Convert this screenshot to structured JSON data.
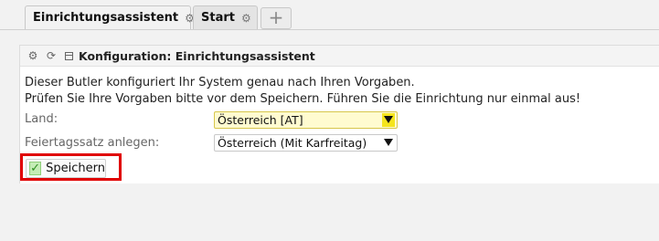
{
  "tabs": [
    {
      "label": "Einrichtungsassistent",
      "icon": "gear-icon",
      "active": true
    },
    {
      "label": "Start",
      "icon": "gear-icon",
      "active": false
    }
  ],
  "add_tab_icon": "plus-icon",
  "panel": {
    "title": "Konfiguration: Einrichtungsassistent",
    "description_line1": "Dieser Butler konfiguriert Ihr System genau nach Ihren Vorgaben.",
    "description_line2": "Prüfen Sie Ihre Vorgaben bitte vor dem Speichern. Führen Sie die Einrichtung nur einmal aus!",
    "fields": {
      "land": {
        "label": "Land:",
        "value": "Österreich [AT]"
      },
      "feiertag": {
        "label": "Feiertagssatz anlegen:",
        "value": "Österreich (Mit Karfreitag)"
      }
    },
    "save_label": "Speichern"
  },
  "colors": {
    "highlight": "#e00000",
    "select_highlight": "#fffbd0"
  }
}
